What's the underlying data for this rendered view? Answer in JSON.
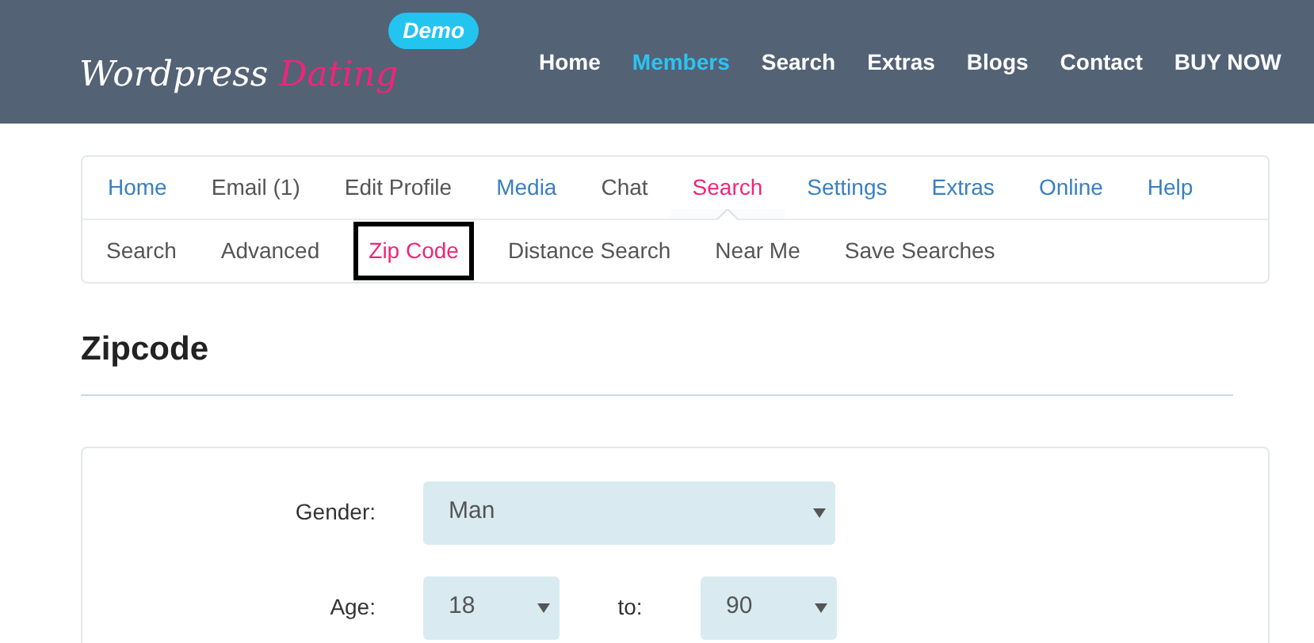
{
  "logo": {
    "first": "Wordpress",
    "second": "Dating",
    "badge": "Demo"
  },
  "main_nav": [
    {
      "label": "Home",
      "selected": false
    },
    {
      "label": "Members",
      "selected": true
    },
    {
      "label": "Search",
      "selected": false
    },
    {
      "label": "Extras",
      "selected": false
    },
    {
      "label": "Blogs",
      "selected": false
    },
    {
      "label": "Contact",
      "selected": false
    },
    {
      "label": "BUY NOW",
      "selected": false
    }
  ],
  "account_tabs": [
    {
      "label": "Home",
      "selected": false,
      "color": "#3a7fc1"
    },
    {
      "label": "Email (1)",
      "selected": false,
      "color": "#555555"
    },
    {
      "label": "Edit Profile",
      "selected": false,
      "color": "#555555"
    },
    {
      "label": "Media",
      "selected": false,
      "color": "#3a7fc1"
    },
    {
      "label": "Chat",
      "selected": false,
      "color": "#555555"
    },
    {
      "label": "Search",
      "selected": true,
      "color": "#f0257a"
    },
    {
      "label": "Settings",
      "selected": false,
      "color": "#3a7fc1"
    },
    {
      "label": "Extras",
      "selected": false,
      "color": "#3a7fc1"
    },
    {
      "label": "Online",
      "selected": false,
      "color": "#3a7fc1"
    },
    {
      "label": "Help",
      "selected": false,
      "color": "#3a7fc1"
    }
  ],
  "search_tabs": [
    {
      "label": "Search",
      "selected": false
    },
    {
      "label": "Advanced",
      "selected": false
    },
    {
      "label": "Zip Code",
      "selected": true
    },
    {
      "label": "Distance Search",
      "selected": false
    },
    {
      "label": "Near Me",
      "selected": false
    },
    {
      "label": "Save Searches",
      "selected": false
    }
  ],
  "heading": "Zipcode",
  "form": {
    "gender": {
      "label": "Gender:",
      "value": "Man"
    },
    "age": {
      "label": "Age:",
      "from": "18",
      "to_label": "to:",
      "to": "90"
    }
  }
}
